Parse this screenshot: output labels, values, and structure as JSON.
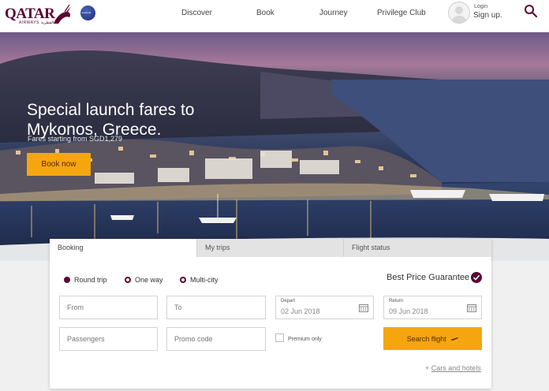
{
  "brand": {
    "logo_text": "QATAR",
    "logo_subtext": "AIRWAYS القطرية",
    "alliance_label": "oneworld",
    "accent": "#5c0632",
    "cta_color": "#f5a60f"
  },
  "nav": {
    "items": [
      "Discover",
      "Book",
      "Journey",
      "Privilege Club"
    ],
    "login_label": "Login",
    "signup_label": "Sign up."
  },
  "icons": {
    "search": "search-icon",
    "calendar": "calendar-icon",
    "plane": "plane-icon",
    "check": "check-icon",
    "avatar": "user-avatar-icon"
  },
  "hero": {
    "title": "Special launch fares to Mykonos, Greece.",
    "subtitle": "Fares starting from SGD1,279",
    "cta_label": "Book now"
  },
  "booking": {
    "tabs": [
      "Booking",
      "My trips",
      "Flight status"
    ],
    "active_tab": "Booking",
    "trip_types": [
      "Round trip",
      "One way",
      "Multi-city"
    ],
    "selected_trip_type": "Round trip",
    "best_price_label": "Best Price Guarantee",
    "from_placeholder": "From",
    "to_placeholder": "To",
    "depart_label": "Depart",
    "depart_value": "02 Jun 2018",
    "return_label": "Return",
    "return_value": "09 Jun 2018",
    "passengers_placeholder": "Passengers",
    "promo_placeholder": "Promo code",
    "premium_label": "Premium only",
    "search_label": "Search flight",
    "cars_prefix": "+",
    "cars_label": "Cars and hotels"
  }
}
